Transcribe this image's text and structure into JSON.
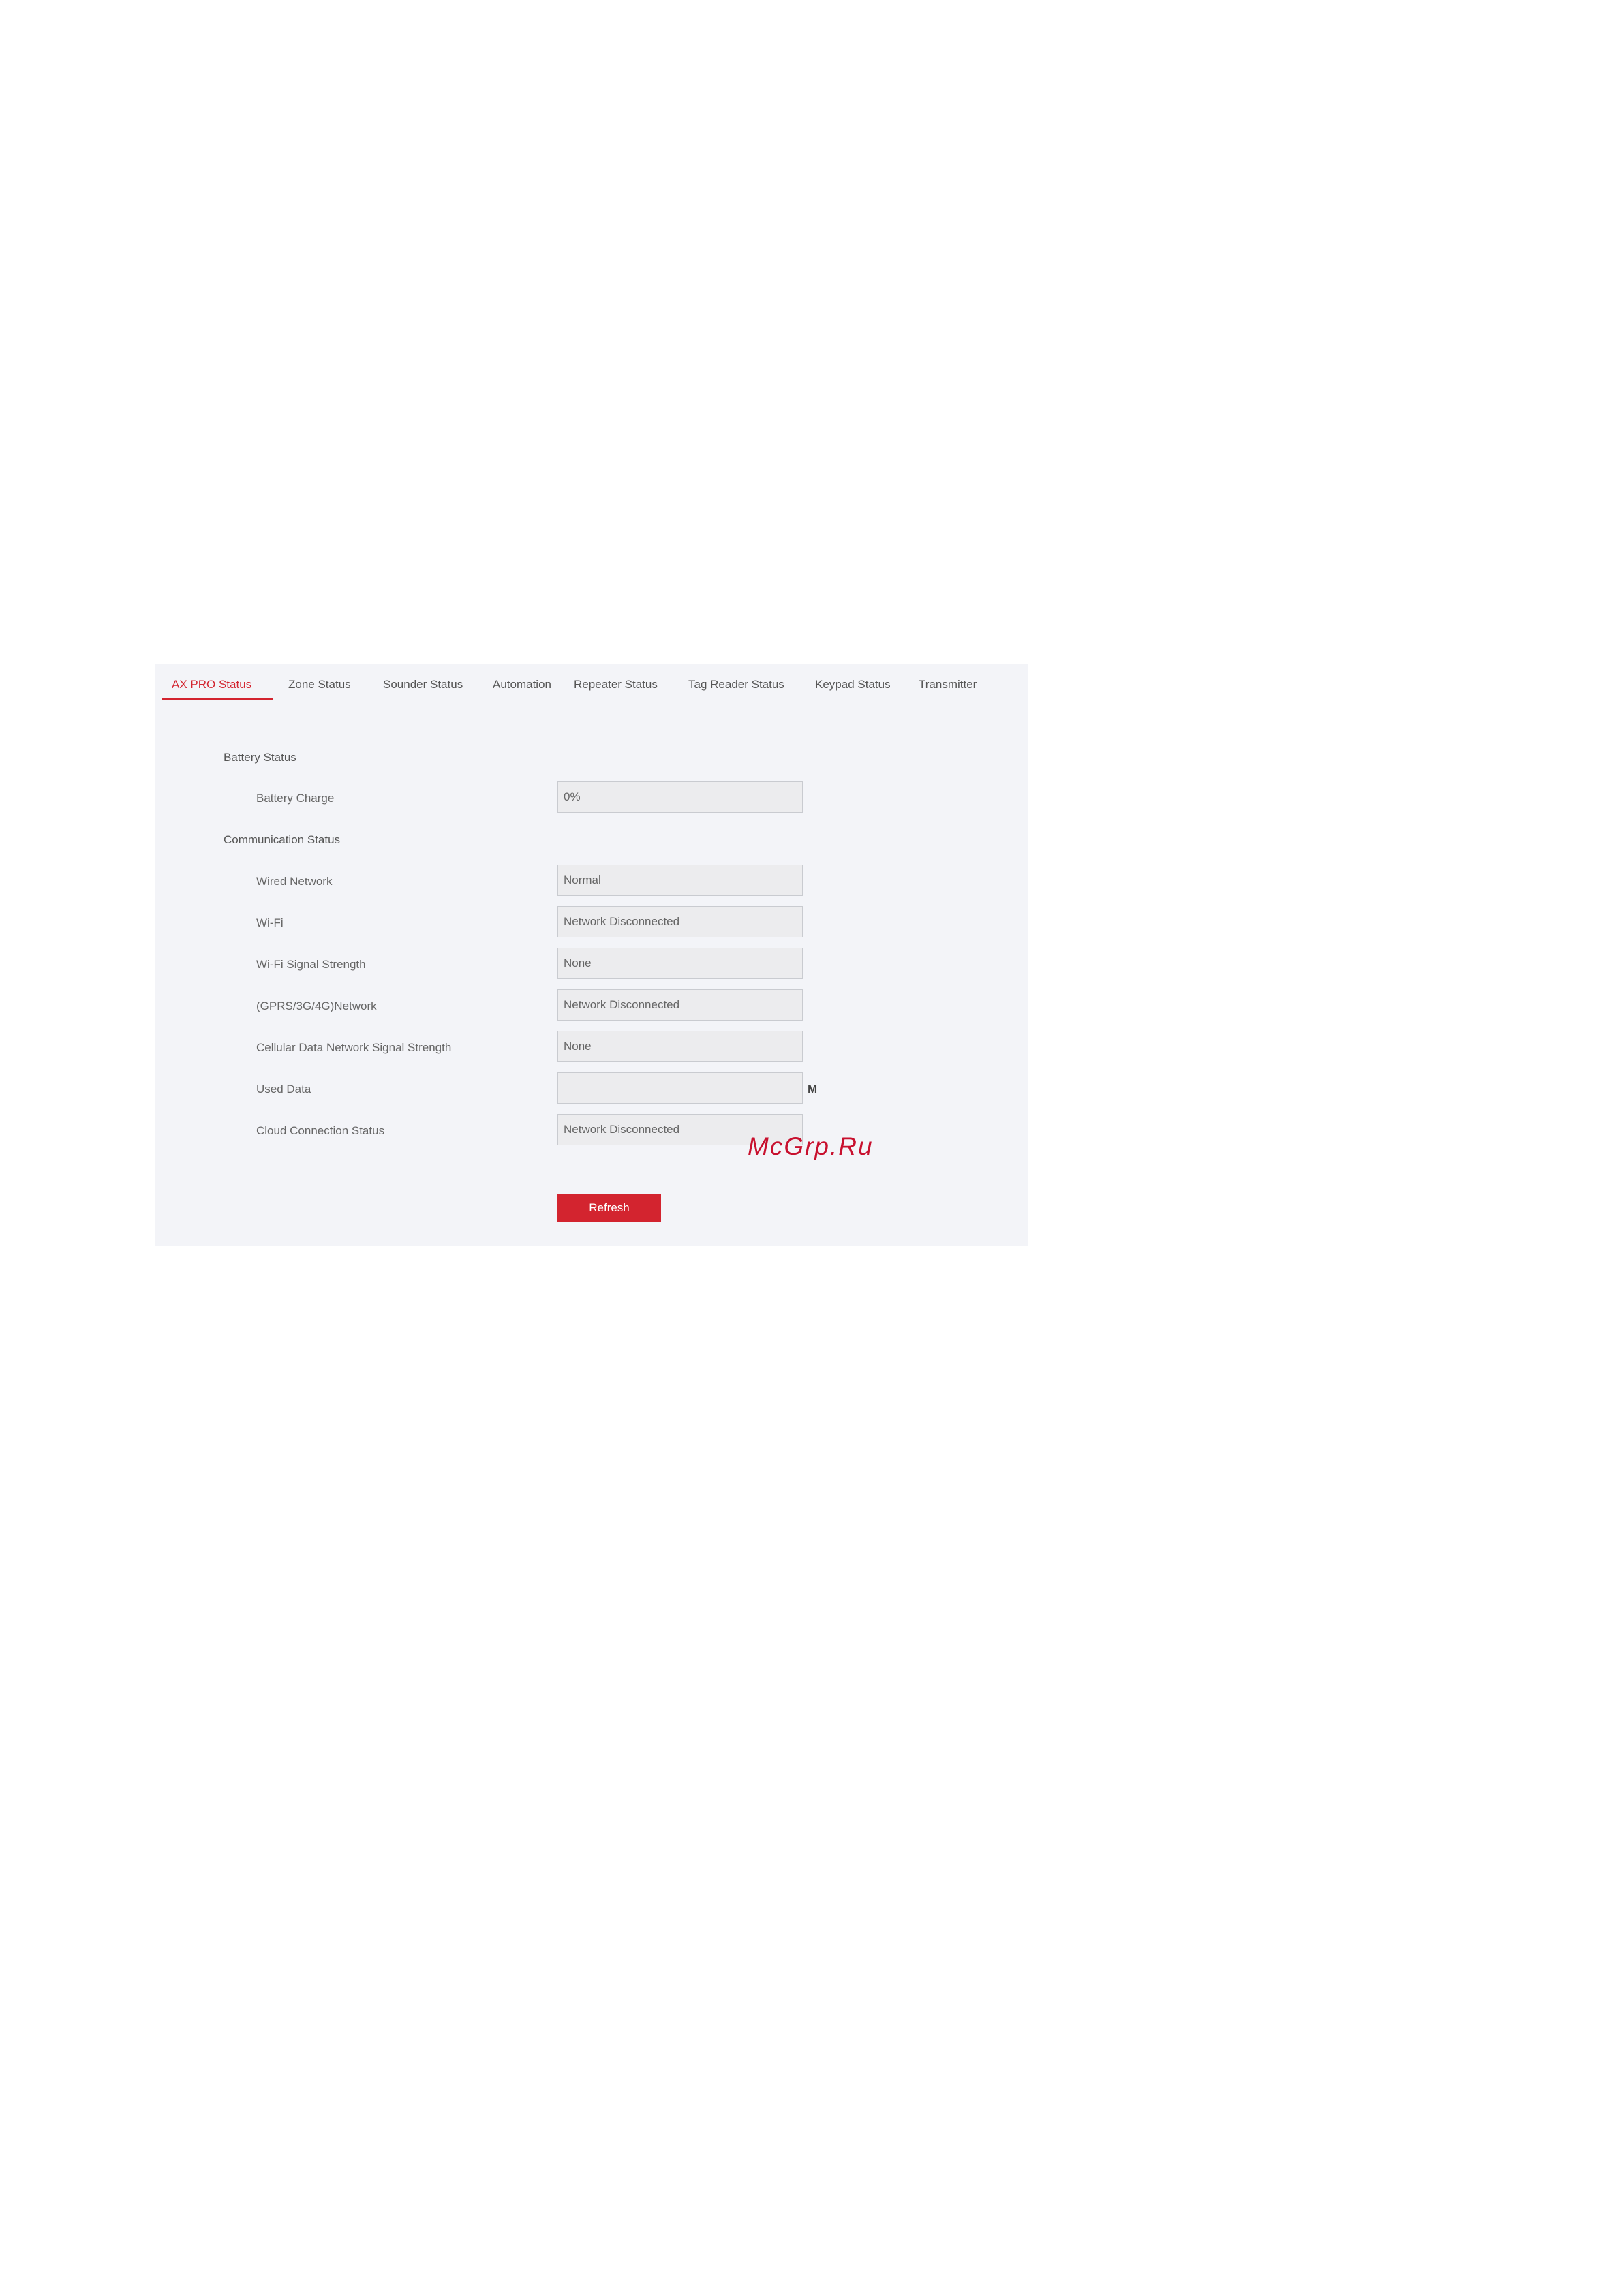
{
  "tabs": [
    {
      "label": "AX PRO Status",
      "active": true
    },
    {
      "label": "Zone Status",
      "active": false
    },
    {
      "label": "Sounder Status",
      "active": false
    },
    {
      "label": "Automation",
      "active": false
    },
    {
      "label": "Repeater Status",
      "active": false
    },
    {
      "label": "Tag Reader Status",
      "active": false
    },
    {
      "label": "Keypad Status",
      "active": false
    },
    {
      "label": "Transmitter",
      "active": false
    }
  ],
  "battery_section": {
    "title": "Battery Status",
    "fields": [
      {
        "label": "Battery Charge",
        "value": "0%"
      }
    ]
  },
  "communication_section": {
    "title": "Communication Status",
    "fields": [
      {
        "label": "Wired Network",
        "value": "Normal"
      },
      {
        "label": "Wi-Fi",
        "value": "Network Disconnected"
      },
      {
        "label": "Wi-Fi Signal Strength",
        "value": "None"
      },
      {
        "label": "(GPRS/3G/4G)Network",
        "value": "Network Disconnected"
      },
      {
        "label": "Cellular Data Network Signal Strength",
        "value": "None"
      },
      {
        "label": "Used Data",
        "value": "",
        "unit": "M"
      },
      {
        "label": "Cloud Connection Status",
        "value": "Network Disconnected"
      }
    ]
  },
  "refresh_label": "Refresh",
  "watermark": "McGrp.Ru",
  "colors": {
    "accent": "#d3242f",
    "panel_background": "#f3f4f8",
    "field_background": "#ececee",
    "watermark": "#c8102e"
  }
}
